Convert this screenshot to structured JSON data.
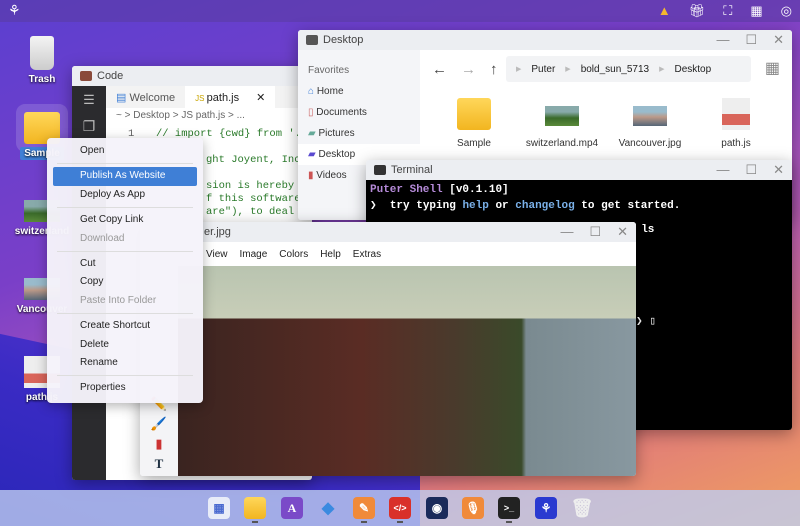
{
  "topbar": {
    "icons": [
      "warning-icon",
      "gift-icon",
      "fullscreen-icon",
      "qr-code-icon",
      "account-icon"
    ]
  },
  "desktop": {
    "items": [
      {
        "label": "Trash"
      },
      {
        "label": "Sample"
      },
      {
        "label": "switzerland"
      },
      {
        "label": "Vancouver"
      },
      {
        "label": "path.js"
      }
    ]
  },
  "code": {
    "title": "Code",
    "tabs": [
      "Welcome",
      "path.js"
    ],
    "breadcrumb": "~ > Desktop > JS path.js > ...",
    "line_number": "1",
    "lines": [
      "// import {cwd} from './env",
      "ght Joyent, Inc. a",
      "sion is hereby gra",
      "f this software an",
      "are\"), to deal in"
    ]
  },
  "files": {
    "title": "Desktop",
    "favorites_label": "Favorites",
    "sidebar": [
      "Home",
      "Documents",
      "Pictures",
      "Desktop",
      "Videos"
    ],
    "selected": "Desktop",
    "path": [
      "Puter",
      "bold_sun_5713",
      "Desktop"
    ],
    "items": [
      "Sample",
      "switzerland.mp4",
      "Vancouver.jpg",
      "path.js"
    ]
  },
  "terminal": {
    "title": "Terminal",
    "shell": "Puter Shell",
    "version": "[v0.1.10]",
    "prompt": "❯",
    "hint_pre": "try typing ",
    "help": "help",
    "or": " or ",
    "changelog": "changelog",
    "hint_post": " to get started.",
    "cmd": "$ ls"
  },
  "paint": {
    "title": "er.jpg",
    "menu": [
      "View",
      "Image",
      "Colors",
      "Help",
      "Extras"
    ],
    "menu_first_visible": "iew"
  },
  "context_menu": {
    "groups": [
      [
        "Open"
      ],
      [
        "Publish As Website",
        "Deploy As App"
      ],
      [
        "Get Copy Link",
        "Download"
      ],
      [
        "Cut",
        "Copy",
        "Paste Into Folder"
      ],
      [
        "Create Shortcut",
        "Delete",
        "Rename"
      ],
      [
        "Properties"
      ]
    ],
    "highlighted": "Publish As Website",
    "disabled": [
      "Download",
      "Paste Into Folder"
    ]
  },
  "taskbar": {
    "apps": [
      "app-grid",
      "files",
      "font-editor",
      "dev-center",
      "paint",
      "code",
      "camera",
      "recorder",
      "terminal",
      "puter",
      "trash"
    ]
  },
  "colors": {
    "accent": "#3f7fd6",
    "terminal_purple": "#b58ad8",
    "terminal_blue": "#7ab0e8"
  }
}
